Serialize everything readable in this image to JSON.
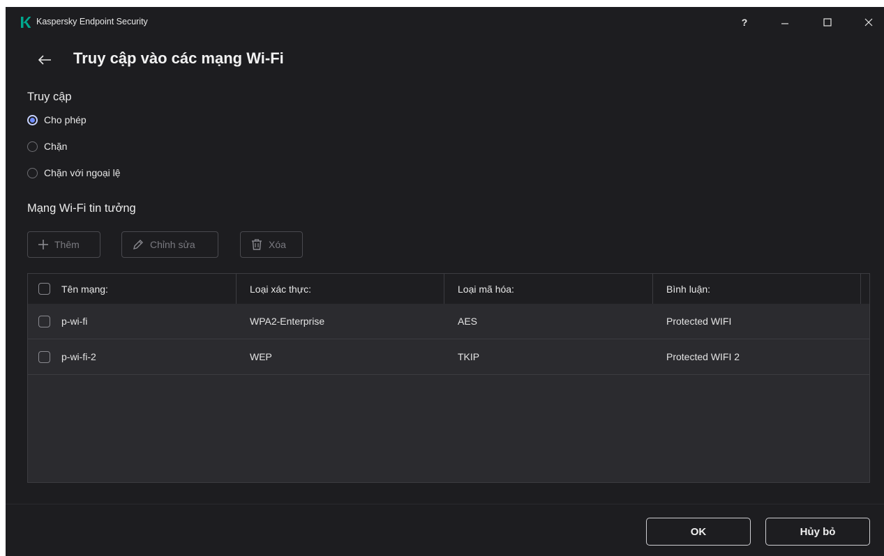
{
  "window": {
    "app_title": "Kaspersky Endpoint Security",
    "help_label": "?",
    "logo_icon": "kaspersky-k-icon",
    "accent_color": "#00a88e"
  },
  "header": {
    "title": "Truy cập vào các mạng Wi-Fi",
    "back_icon": "arrow-left-icon"
  },
  "access": {
    "title": "Truy cập",
    "options": [
      {
        "label": "Cho phép",
        "checked": true
      },
      {
        "label": "Chặn",
        "checked": false
      },
      {
        "label": "Chặn với ngoại lệ",
        "checked": false
      }
    ],
    "selected_color": "#6f8cff"
  },
  "trusted": {
    "title": "Mạng Wi-Fi tin tưởng",
    "toolbar": {
      "add_label": "Thêm",
      "edit_label": "Chỉnh sửa",
      "delete_label": "Xóa",
      "disabled": true
    },
    "table": {
      "columns": [
        "Tên mạng:",
        "Loại xác thực:",
        "Loại mã hóa:",
        "Bình luận:"
      ],
      "rows": [
        {
          "name": "p-wi-fi",
          "auth": "WPA2-Enterprise",
          "encryption": "AES",
          "comment": "Protected WIFI"
        },
        {
          "name": "p-wi-fi-2",
          "auth": "WEP",
          "encryption": "TKIP",
          "comment": "Protected WIFI 2"
        }
      ]
    }
  },
  "footer": {
    "ok_label": "OK",
    "cancel_label": "Hủy bỏ"
  }
}
